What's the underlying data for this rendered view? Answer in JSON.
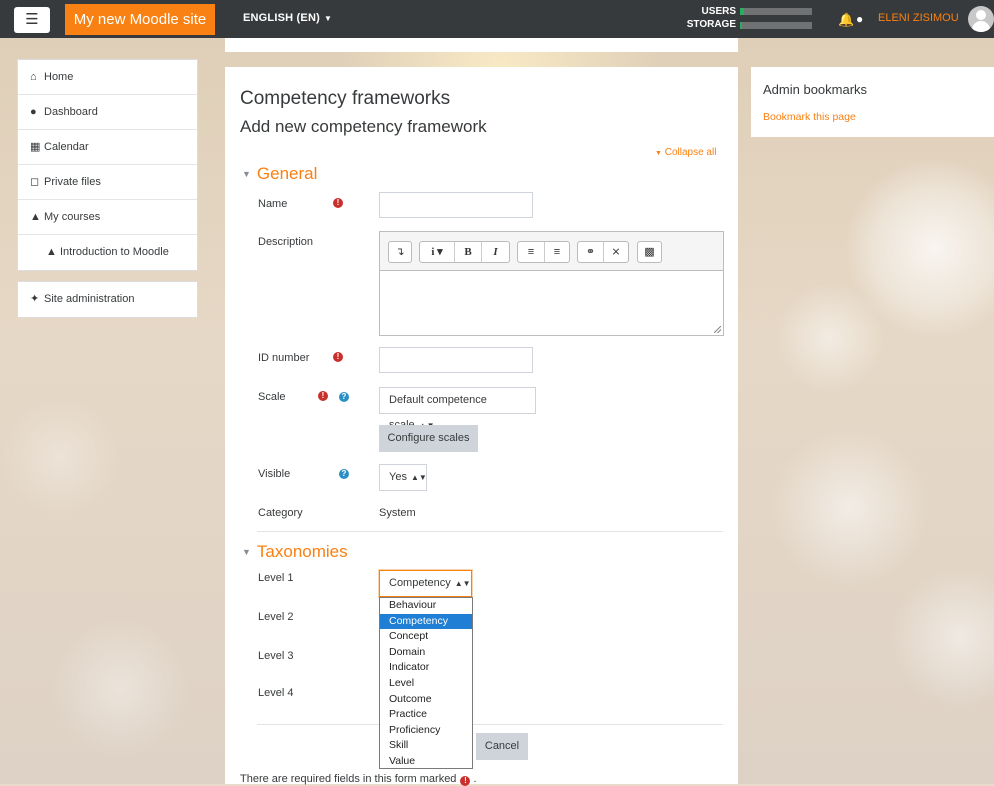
{
  "navbar": {
    "menu_icon": "hamburger-icon",
    "site_name": "My new Moodle site",
    "language": "ENGLISH (EN)",
    "usage_users": "USERS",
    "usage_storage": "STORAGE",
    "user_name": "ELENI ZISIMOU"
  },
  "drawer": {
    "items": [
      {
        "label": "Home",
        "icon": "home-icon"
      },
      {
        "label": "Dashboard",
        "icon": "dashboard-icon"
      },
      {
        "label": "Calendar",
        "icon": "calendar-icon"
      },
      {
        "label": "Private files",
        "icon": "file-icon"
      },
      {
        "label": "My courses",
        "icon": "graduation-cap-icon"
      },
      {
        "label": "Introduction to Moodle",
        "icon": "graduation-cap-icon"
      }
    ],
    "admin": {
      "label": "Site administration",
      "icon": "wrench-icon"
    }
  },
  "page": {
    "heading": "Competency frameworks",
    "subheading": "Add new competency framework",
    "collapse_all": "Collapse all"
  },
  "general": {
    "title": "General",
    "name_label": "Name",
    "description_label": "Description",
    "idnumber_label": "ID number",
    "scale_label": "Scale",
    "scale_value": "Default competence scale",
    "configure_scales": "Configure scales",
    "visible_label": "Visible",
    "visible_value": "Yes",
    "category_label": "Category",
    "category_value": "System"
  },
  "taxonomies": {
    "title": "Taxonomies",
    "level1_label": "Level 1",
    "level2_label": "Level 2",
    "level3_label": "Level 3",
    "level4_label": "Level 4",
    "level1_value": "Competency",
    "options": [
      "Behaviour",
      "Competency",
      "Concept",
      "Domain",
      "Indicator",
      "Level",
      "Outcome",
      "Practice",
      "Proficiency",
      "Skill",
      "Value"
    ],
    "selected_option": "Competency"
  },
  "actions": {
    "cancel": "Cancel"
  },
  "footnote": "There are required fields in this form marked",
  "admin_bookmarks": {
    "title": "Admin bookmarks",
    "link": "Bookmark this page"
  },
  "colors": {
    "brand": "#f98012",
    "navbar": "#373a3c",
    "required": "#c9302c",
    "help": "#2b8fc4",
    "selected_option": "#1e7fd4"
  }
}
